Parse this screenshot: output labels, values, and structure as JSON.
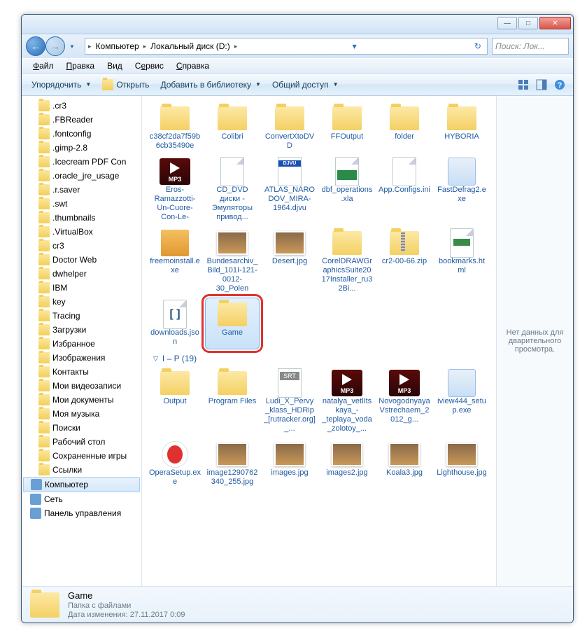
{
  "titlebar": {
    "minimize": "—",
    "maximize": "□",
    "close": "✕"
  },
  "breadcrumb": {
    "computer": "Компьютер",
    "drive": "Локальный диск (D:)"
  },
  "search": {
    "placeholder": "Поиск: Лок..."
  },
  "menu": {
    "file": "Файл",
    "edit": "Правка",
    "view": "Вид",
    "tools": "Сервис",
    "help": "Справка"
  },
  "toolbar": {
    "organize": "Упорядочить",
    "open": "Открыть",
    "addtolib": "Добавить в библиотеку",
    "share": "Общий доступ"
  },
  "sidebar": {
    "items": [
      ".cr3",
      ".FBReader",
      ".fontconfig",
      ".gimp-2.8",
      ".Icecream PDF Con",
      ".oracle_jre_usage",
      ".r.saver",
      ".swt",
      ".thumbnails",
      ".VirtualBox",
      "cr3",
      "Doctor Web",
      "dwhelper",
      "IBM",
      "key",
      "Tracing",
      "Загрузки",
      "Избранное",
      "Изображения",
      "Контакты",
      "Мои видеозаписи",
      "Мои документы",
      "Моя музыка",
      "Поиски",
      "Рабочий стол",
      "Сохраненные игры",
      "Ссылки"
    ],
    "computer": "Компьютер",
    "network": "Сеть",
    "control": "Панель управления"
  },
  "grid": {
    "row1": [
      {
        "name": "c38cf2da7f59b6cb35490e",
        "type": "folder"
      },
      {
        "name": "Colibri",
        "type": "folder"
      },
      {
        "name": "ConvertXtoDVD",
        "type": "folder"
      },
      {
        "name": "FFOutput",
        "type": "folder"
      },
      {
        "name": "folder",
        "type": "folder"
      },
      {
        "name": "HYBORIA",
        "type": "folder"
      }
    ],
    "row2": [
      {
        "name": "Eros-Ramazzotti-Un-Cuore-Con-Le-Ali(muz...",
        "type": "mp3"
      },
      {
        "name": "CD_DVD диски - Эмуляторы привод...",
        "type": "file"
      },
      {
        "name": "ATLAS_NARODOV_MIRA-1964.djvu",
        "type": "djvu"
      },
      {
        "name": "dbf_operations.xla",
        "type": "xla"
      },
      {
        "name": "App.Configs.ini",
        "type": "file"
      },
      {
        "name": "FastDefrag2.exe",
        "type": "exe"
      }
    ],
    "row3": [
      {
        "name": "freemoinstall.exe",
        "type": "box"
      },
      {
        "name": "Bundesarchiv_Bild_101I-121-0012-30_Polen",
        "type": "photo"
      },
      {
        "name": "Desert.jpg",
        "type": "photo"
      },
      {
        "name": "CorelDRAWGraphicsSuite2017Installer_ru32Bi...",
        "type": "folder"
      },
      {
        "name": "cr2-00-66.zip",
        "type": "zip"
      },
      {
        "name": "bookmarks.html",
        "type": "html"
      }
    ],
    "row4": [
      {
        "name": "downloads.json",
        "type": "json"
      },
      {
        "name": "Game",
        "type": "folder",
        "selected": true,
        "highlighted": true
      }
    ],
    "group2_header": "I – P (19)",
    "row5": [
      {
        "name": "Output",
        "type": "folder"
      },
      {
        "name": "Program Files",
        "type": "folder"
      },
      {
        "name": "Ludi_X_Pervy_klass_HDRip_[rutracker.org]_...",
        "type": "srt"
      },
      {
        "name": "natalya_vetlItskaya_-_teplaya_voda_zolotoy_...",
        "type": "mp3"
      },
      {
        "name": "NovogodnyayaVstrechaem_2012_g...",
        "type": "mp3"
      },
      {
        "name": "iview444_setup.exe",
        "type": "exe"
      }
    ],
    "row6": [
      {
        "name": "OperaSetup.exe",
        "type": "opera"
      },
      {
        "name": "image1290762340_255.jpg",
        "type": "photo"
      },
      {
        "name": "images.jpg",
        "type": "photo"
      },
      {
        "name": "images2.jpg",
        "type": "photo"
      },
      {
        "name": "Koala3.jpg",
        "type": "photo"
      },
      {
        "name": "Lighthouse.jpg",
        "type": "photo"
      }
    ]
  },
  "preview": {
    "empty": "Нет данных для дварительного просмотра."
  },
  "status": {
    "name": "Game",
    "type": "Папка с файлами",
    "datelabel": "Дата изменения:",
    "date": "27.11.2017 0:09"
  }
}
